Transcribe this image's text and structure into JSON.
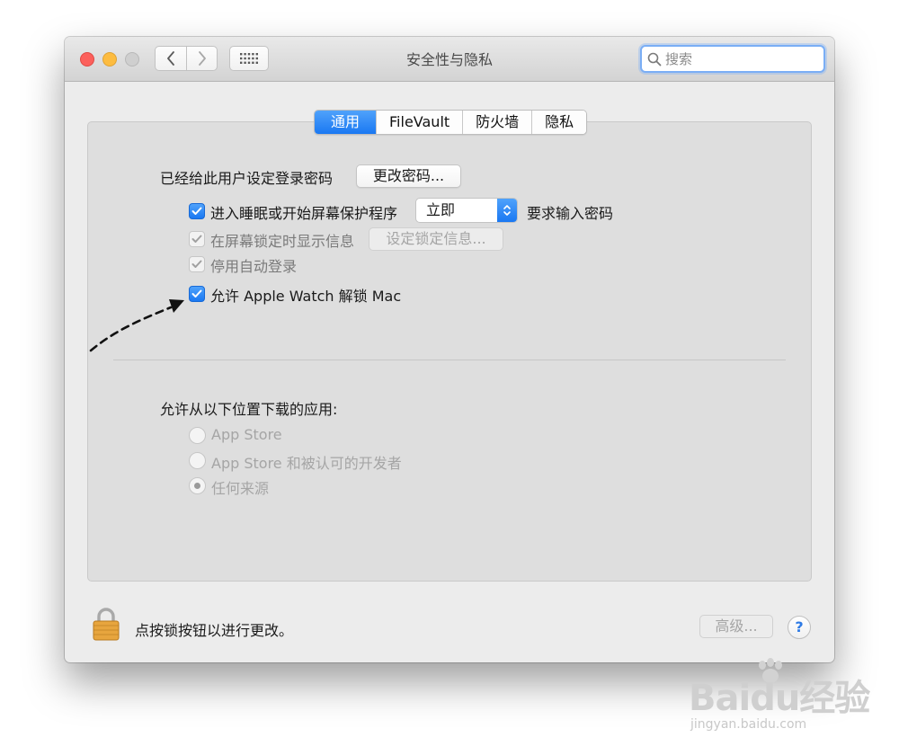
{
  "window": {
    "title": "安全性与隐私"
  },
  "search": {
    "placeholder": "搜索",
    "value": ""
  },
  "tabs": [
    {
      "label": "通用",
      "active": true
    },
    {
      "label": "FileVault",
      "active": false
    },
    {
      "label": "防火墙",
      "active": false
    },
    {
      "label": "隐私",
      "active": false
    }
  ],
  "general": {
    "password_set_label": "已经给此用户设定登录密码",
    "change_password_button": "更改密码...",
    "require_password": {
      "label": "进入睡眠或开始屏幕保护程序",
      "checked": true,
      "select_value": "立即",
      "suffix": "要求输入密码"
    },
    "show_message": {
      "label": "在屏幕锁定时显示信息",
      "checked": true,
      "disabled": true,
      "button": "设定锁定信息..."
    },
    "disable_auto_login": {
      "label": "停用自动登录",
      "checked": true,
      "disabled": true
    },
    "apple_watch": {
      "label": "允许 Apple Watch 解锁 Mac",
      "checked": true
    }
  },
  "downloads": {
    "heading": "允许从以下位置下载的应用:",
    "options": [
      {
        "label": "App Store",
        "selected": false
      },
      {
        "label": "App Store 和被认可的开发者",
        "selected": false
      },
      {
        "label": "任何来源",
        "selected": true
      }
    ]
  },
  "footer": {
    "lock_text": "点按锁按钮以进行更改。",
    "advanced_button": "高级...",
    "help_button": "?"
  },
  "watermark": {
    "brand": "Baidu经验",
    "url": "jingyan.baidu.com"
  },
  "colors": {
    "accent": "#1a78f2",
    "close": "#fc605c",
    "minimize": "#fdbc40",
    "zoom_disabled": "#cfcfcf"
  }
}
